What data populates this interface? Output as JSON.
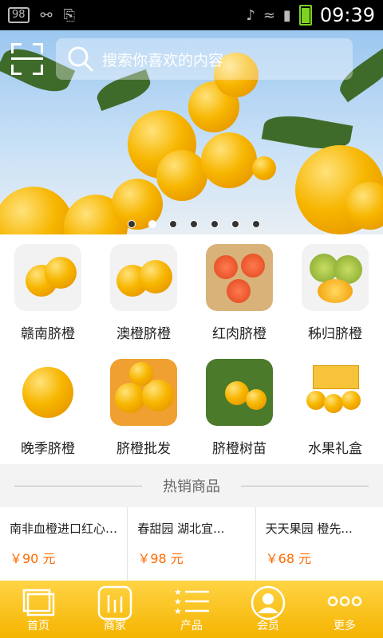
{
  "statusbar": {
    "badge": "98",
    "time": "09:39"
  },
  "search": {
    "placeholder": "搜索你喜欢的内容"
  },
  "carousel": {
    "dots": 7,
    "active_index": 1
  },
  "categories": [
    {
      "label": "赣南脐橙",
      "icon": "orange-halves-icon"
    },
    {
      "label": "澳橙脐橙",
      "icon": "orange-halves-icon"
    },
    {
      "label": "红肉脐橙",
      "icon": "blood-orange-icon"
    },
    {
      "label": "秭归脐橙",
      "icon": "green-orange-icon"
    },
    {
      "label": "晚季脐橙",
      "icon": "orange-slice-icon"
    },
    {
      "label": "脐橙批发",
      "icon": "orange-pile-icon"
    },
    {
      "label": "脐橙树苗",
      "icon": "orange-tree-icon"
    },
    {
      "label": "水果礼盒",
      "icon": "gift-box-icon"
    }
  ],
  "hot": {
    "title": "热销商品"
  },
  "products": [
    {
      "name": "南非血橙进口红心橙...",
      "price": "￥90 元"
    },
    {
      "name": "春甜园 湖北宜...",
      "price": "￥98 元"
    },
    {
      "name": "天天果园 橙先...",
      "price": "￥68 元"
    }
  ],
  "tabs": [
    {
      "label": "首页",
      "icon": "home-icon"
    },
    {
      "label": "商家",
      "icon": "merchant-icon"
    },
    {
      "label": "产品",
      "icon": "list-icon"
    },
    {
      "label": "会员",
      "icon": "member-icon"
    },
    {
      "label": "更多",
      "icon": "more-icon"
    }
  ],
  "colors": {
    "tabbar": "#f5b400",
    "price": "#ff6a00",
    "battery": "#7ed321"
  }
}
